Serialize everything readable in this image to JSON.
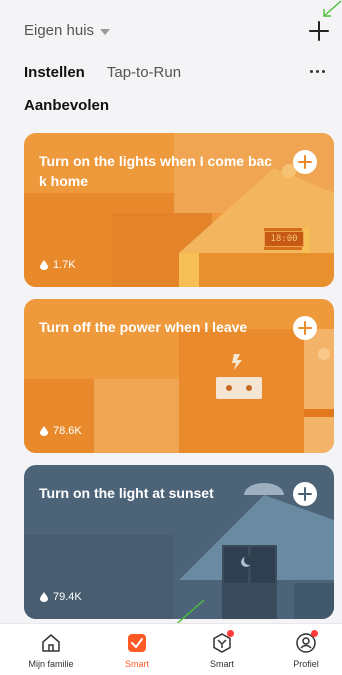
{
  "header": {
    "home_name": "Eigen huis",
    "add_icon": "plus-icon",
    "dropdown_icon": "caret-down-icon"
  },
  "tabs": [
    {
      "label": "Instellen",
      "active": true
    },
    {
      "label": "Tap-to-Run",
      "active": false
    }
  ],
  "more_icon": "more-dots-icon",
  "section_title": "Aanbevolen",
  "cards": [
    {
      "title": "Turn on the lights when I come back home",
      "count": "1.7K",
      "clock": "18:00",
      "bg": "#ee9a3c",
      "plus_color": "#ef8a2a"
    },
    {
      "title": "Turn off the power when I leave",
      "count": "78.6K",
      "bg": "#ee9a3c",
      "plus_color": "#ef8a2a"
    },
    {
      "title": "Turn on the light at sunset",
      "count": "79.4K",
      "bg": "#4d6478",
      "plus_color": "#4d6478"
    }
  ],
  "bottom_nav": [
    {
      "label": "Mijn familie",
      "icon": "home-icon",
      "active": false
    },
    {
      "label": "Smart",
      "icon": "check-square-icon",
      "active": true
    },
    {
      "label": "Smart",
      "icon": "smart-hub-icon",
      "active": false
    },
    {
      "label": "Profiel",
      "icon": "profile-icon",
      "active": false
    }
  ],
  "colors": {
    "accent": "#ff5a26",
    "annotation_arrow": "#4bbf3a",
    "background": "#f4f4f6"
  }
}
